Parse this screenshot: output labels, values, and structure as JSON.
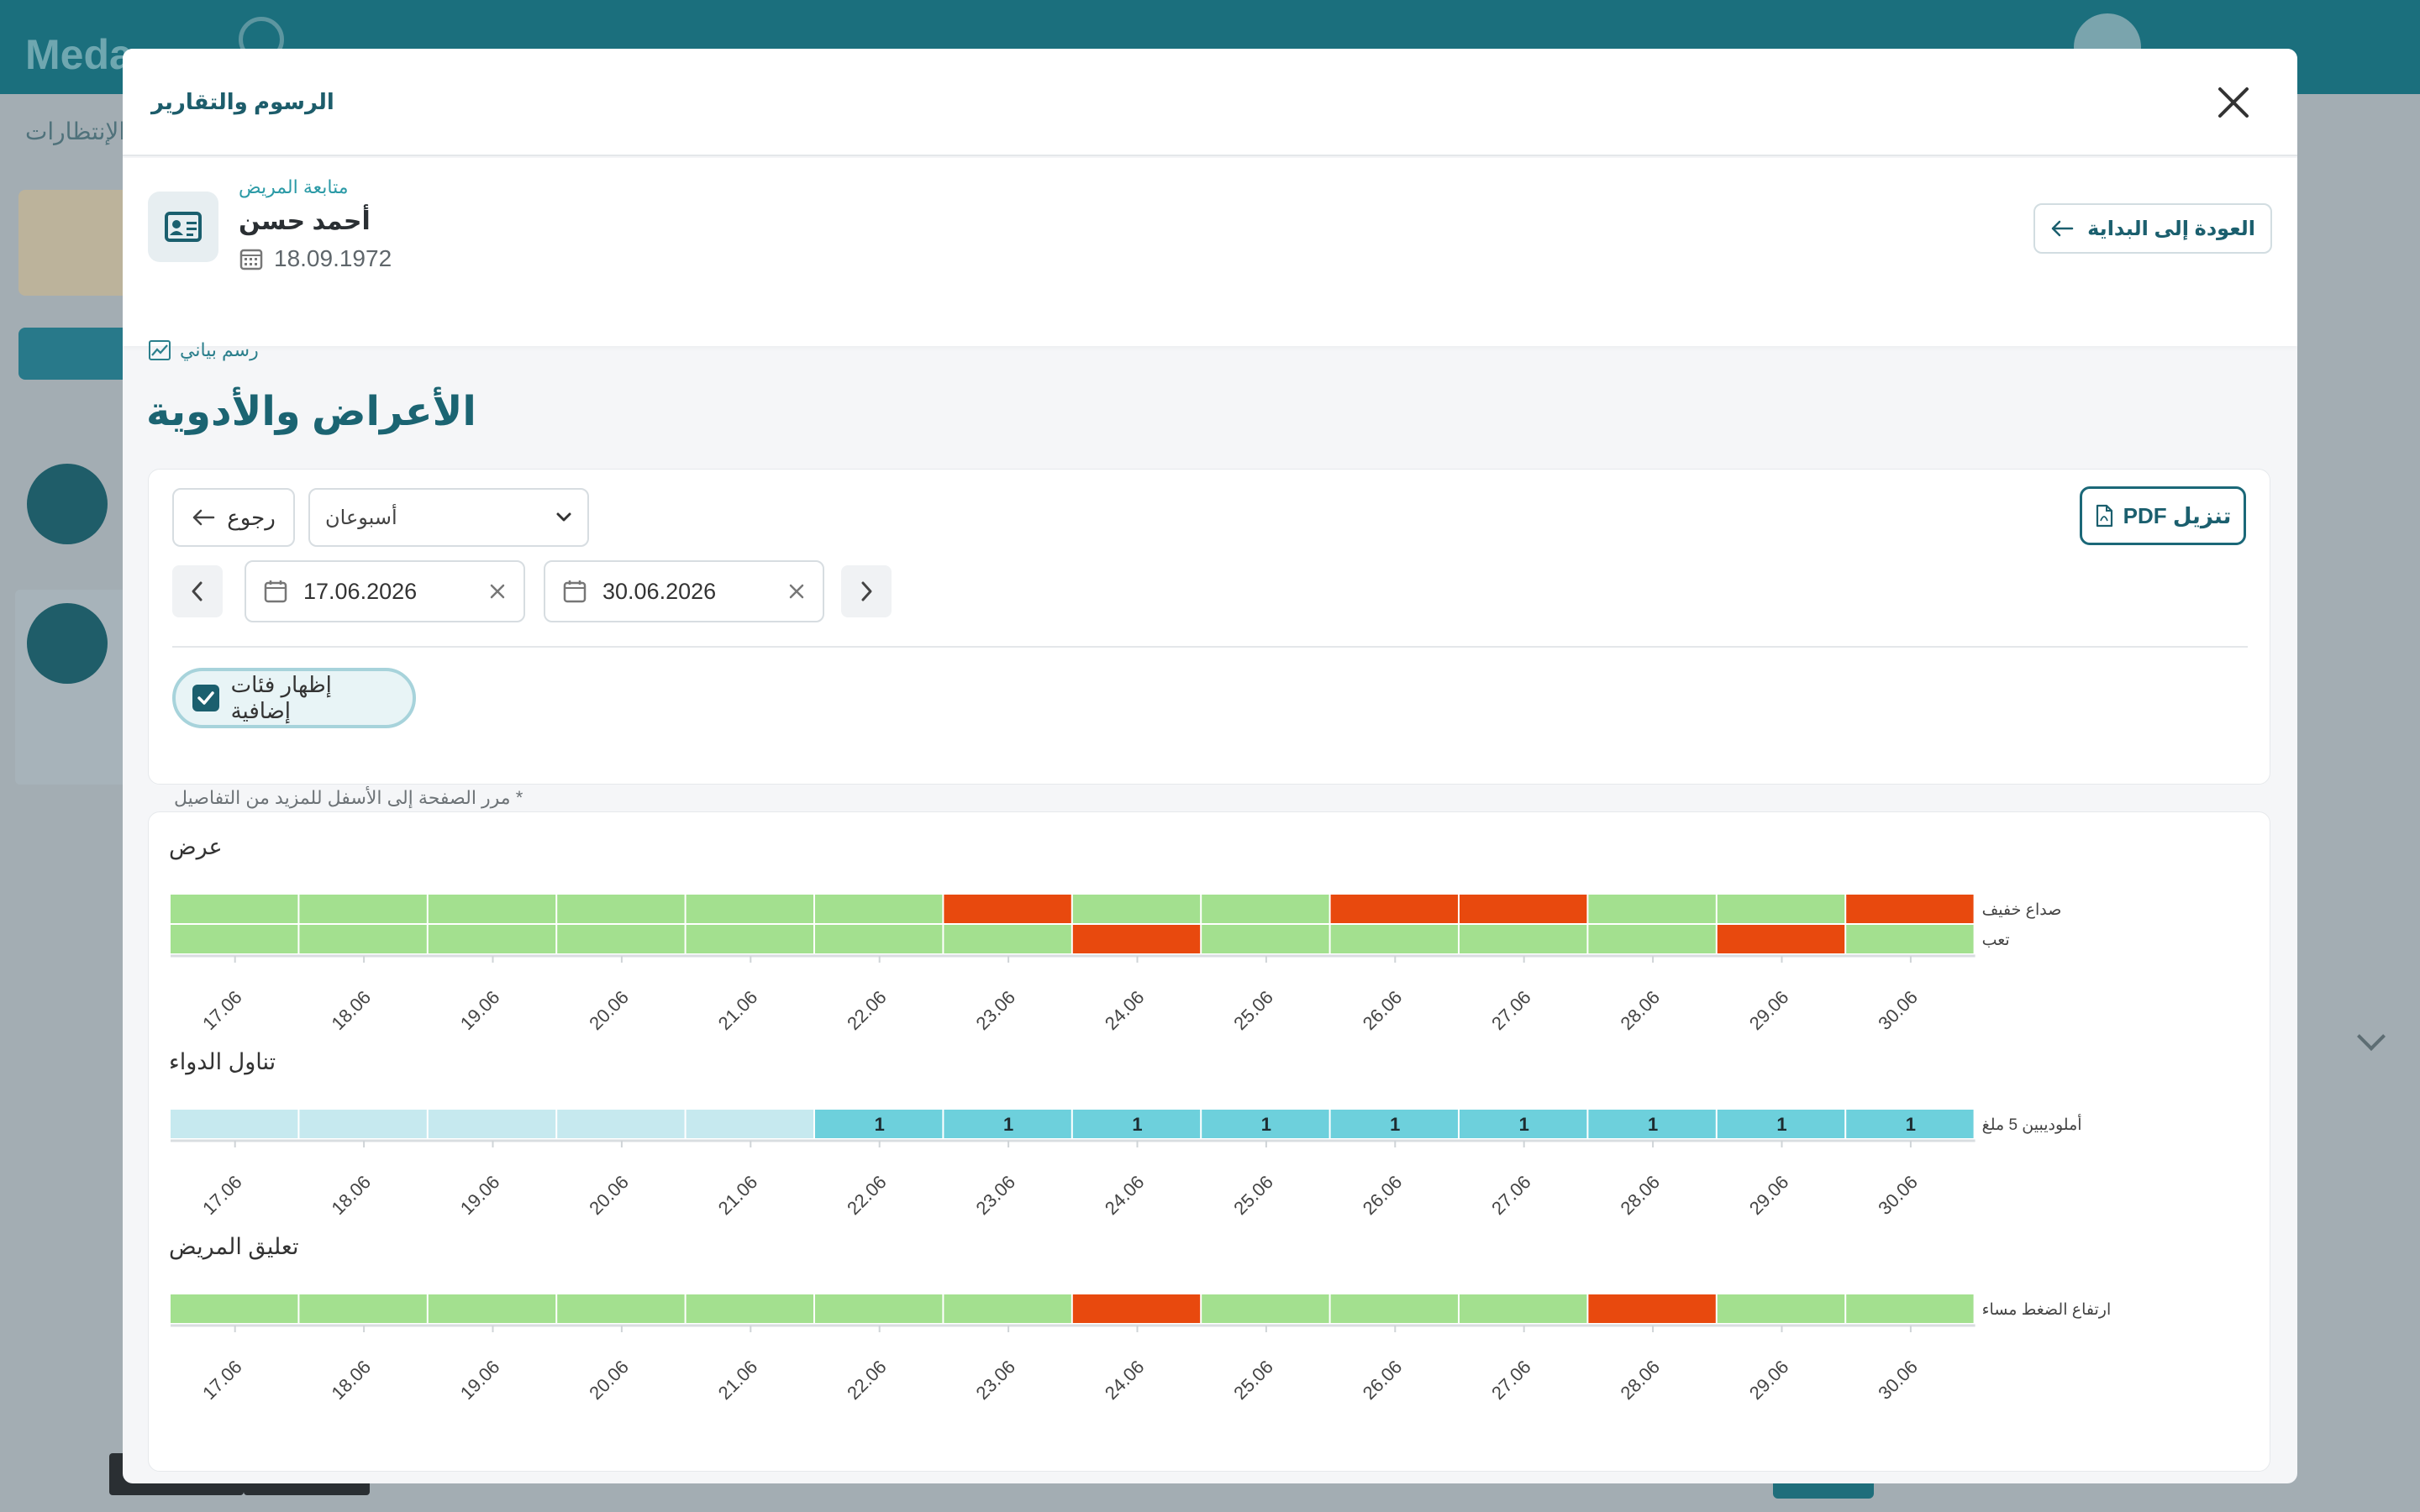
{
  "background": {
    "brand": "Meda",
    "tabs_label": "الإنتظارات"
  },
  "modal": {
    "title": "الرسوم والتقارير",
    "close_icon": "close-icon"
  },
  "patient": {
    "subtitle": "متابعة المريض",
    "name": "أحمد حسن",
    "dob": "18.09.1972",
    "back_to_start": "العودة إلى البداية"
  },
  "page": {
    "chart_link": "رسم بياني",
    "heading": "الأعراض والأدوية"
  },
  "controls": {
    "pdf_label": "PDF تنزيل",
    "back_label": "رجوع",
    "period_value": "أسبوعان",
    "date_from": "17.06.2026",
    "date_to": "30.06.2026",
    "toggle_label": "إظهار فئات إضافية",
    "toggle_checked": true,
    "hint": "مرر الصفحة إلى الأسفل للمزيد من التفاصيل *"
  },
  "colors": {
    "ok": "#a3e08f",
    "bad": "#e8490e",
    "med_taken": "#6dd0dc",
    "med_empty": "#c6e9ef",
    "accent": "#1b6472"
  },
  "chart_data": [
    {
      "type": "heatmap",
      "title": "عرض",
      "x": [
        "17.06",
        "18.06",
        "19.06",
        "20.06",
        "21.06",
        "22.06",
        "23.06",
        "24.06",
        "25.06",
        "26.06",
        "27.06",
        "28.06",
        "29.06",
        "30.06"
      ],
      "rows": [
        {
          "name": "صداع خفيف",
          "values": [
            0,
            0,
            0,
            0,
            0,
            0,
            1,
            0,
            0,
            1,
            1,
            0,
            0,
            1
          ]
        },
        {
          "name": "تعب",
          "values": [
            0,
            0,
            0,
            0,
            0,
            0,
            0,
            1,
            0,
            0,
            0,
            0,
            1,
            0
          ]
        }
      ]
    },
    {
      "type": "heatmap",
      "title": "تناول الدواء",
      "x": [
        "17.06",
        "18.06",
        "19.06",
        "20.06",
        "21.06",
        "22.06",
        "23.06",
        "24.06",
        "25.06",
        "26.06",
        "27.06",
        "28.06",
        "29.06",
        "30.06"
      ],
      "rows": [
        {
          "name": "أملوديبين 5 ملغ",
          "values": [
            null,
            null,
            null,
            null,
            null,
            1,
            1,
            1,
            1,
            1,
            1,
            1,
            1,
            1
          ]
        }
      ]
    },
    {
      "type": "heatmap",
      "title": "تعليق المريض",
      "x": [
        "17.06",
        "18.06",
        "19.06",
        "20.06",
        "21.06",
        "22.06",
        "23.06",
        "24.06",
        "25.06",
        "26.06",
        "27.06",
        "28.06",
        "29.06",
        "30.06"
      ],
      "rows": [
        {
          "name": "ارتفاع الضغط مساء",
          "values": [
            0,
            0,
            0,
            0,
            0,
            0,
            0,
            1,
            0,
            0,
            0,
            1,
            0,
            0
          ]
        }
      ]
    }
  ]
}
